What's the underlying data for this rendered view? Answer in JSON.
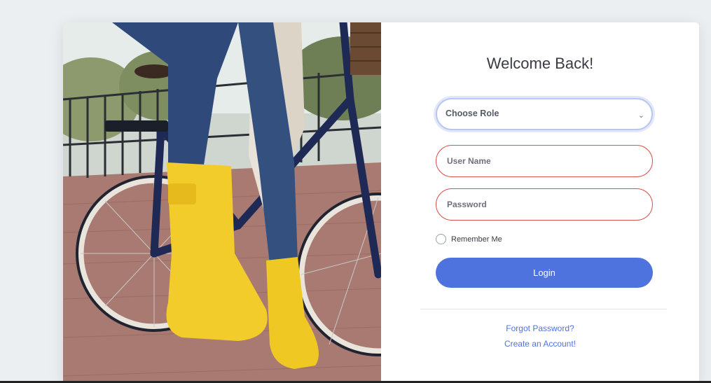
{
  "photo": {
    "description_icon": "bicycle-yellow-boots-photo"
  },
  "form": {
    "title": "Welcome Back!",
    "role_select": {
      "value": "Choose Role",
      "icon": "chevron-down-icon"
    },
    "username": {
      "placeholder": "User Name"
    },
    "password": {
      "placeholder": "Password"
    },
    "remember_label": "Remember Me",
    "login_label": "Login",
    "forgot_link": "Forgot Password?",
    "create_link": "Create an Account!"
  },
  "colors": {
    "primary": "#4e73df",
    "error_border": "#d9534f",
    "background": "#eceff1"
  }
}
